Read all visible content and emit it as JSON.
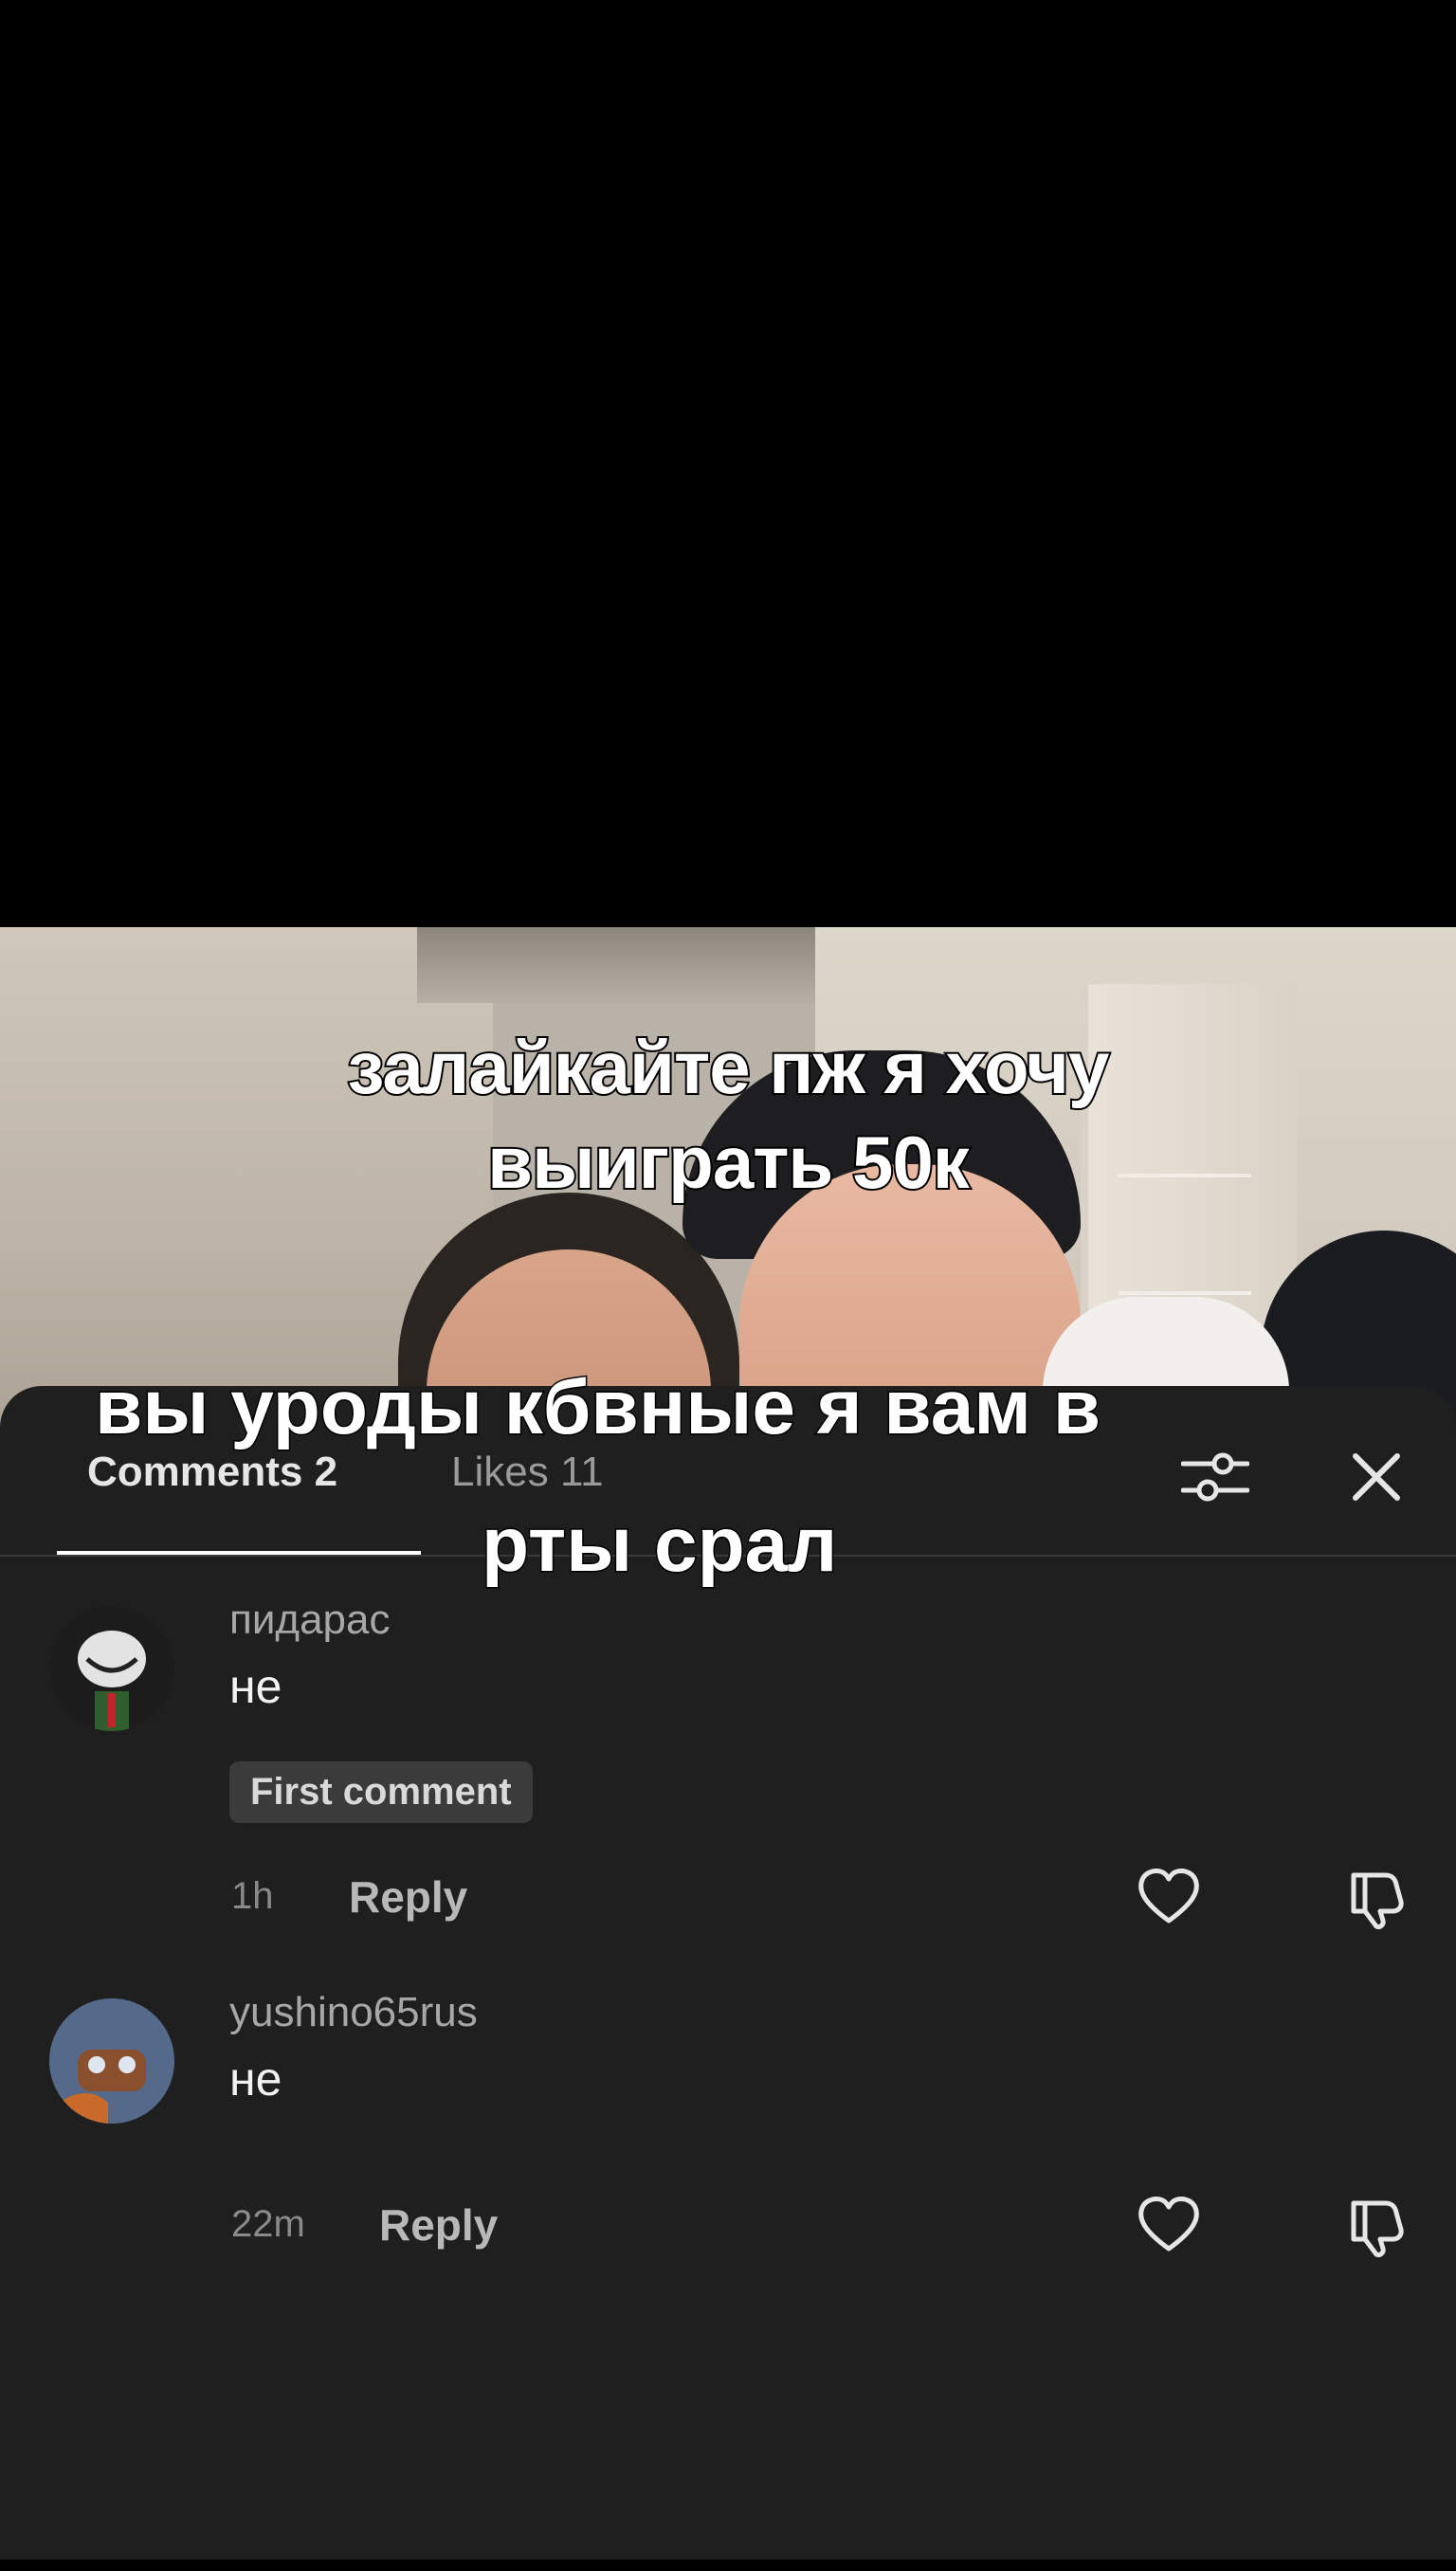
{
  "video": {
    "caption_line1": "залайкайте пж я хочу",
    "caption_line2": "выиграть 50к"
  },
  "sticker_caption": {
    "line1": "вы уроды кбвные я вам в",
    "line2": "рты срал"
  },
  "sheet": {
    "tabs": {
      "comments": "Comments 2",
      "likes": "Likes 11"
    },
    "icons": {
      "filter": "filter-sliders-icon",
      "close": "close-icon"
    }
  },
  "comments": [
    {
      "username": "пидарас",
      "text": "не",
      "badge": "First comment",
      "time": "1h",
      "reply_label": "Reply"
    },
    {
      "username": "yushino65rus",
      "text": "не",
      "time": "22m",
      "reply_label": "Reply"
    }
  ],
  "colors": {
    "sheet_bg": "#1f1f1f",
    "text_primary": "#f2f2f2",
    "text_secondary": "#a7a7a7"
  }
}
